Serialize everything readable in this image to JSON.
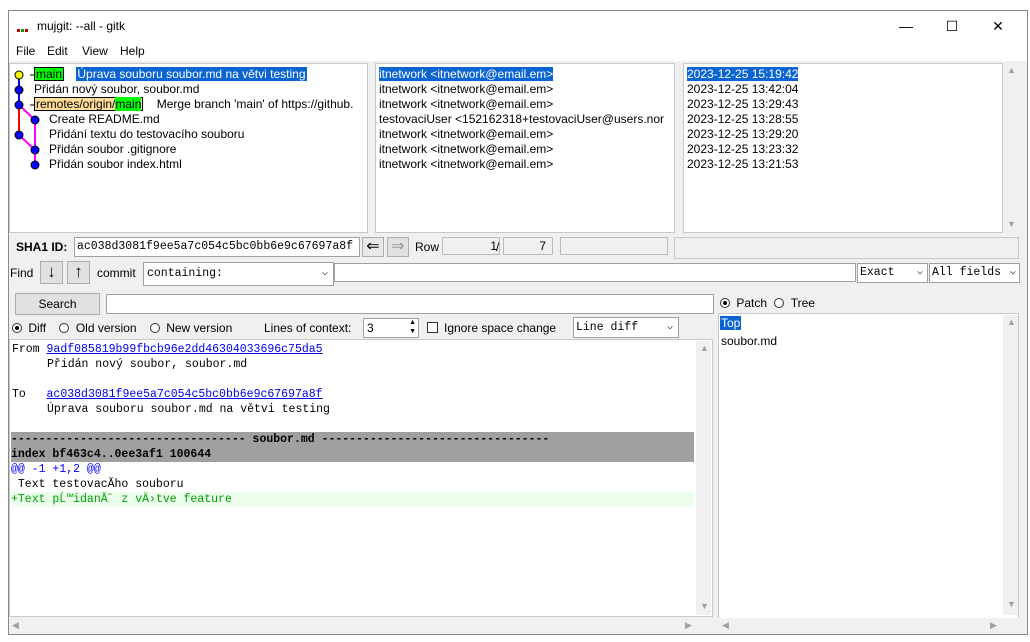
{
  "window": {
    "title": "mujgit: --all - gitk",
    "minimize": "—",
    "maximize": "☐",
    "close": "✕"
  },
  "menu": [
    "File",
    "Edit",
    "View",
    "Help"
  ],
  "commits": [
    {
      "tags": [
        {
          "kind": "main",
          "text": "main"
        }
      ],
      "message": "Úprava souboru soubor.md na větvi testing",
      "author": "itnetwork <itnetwork@email.em>",
      "date": "2023-12-25 15:19:42",
      "selected": true
    },
    {
      "tags": [],
      "message": "Přidán nový soubor, soubor.md",
      "author": "itnetwork <itnetwork@email.em>",
      "date": "2023-12-25 13:42:04",
      "selected": false
    },
    {
      "tags": [
        {
          "kind": "remote",
          "text": "remotes/origin/"
        },
        {
          "kind": "main",
          "text": "main"
        }
      ],
      "message": "Merge branch 'main' of https://github.",
      "author": "itnetwork <itnetwork@email.em>",
      "date": "2023-12-25 13:29:43",
      "selected": false
    },
    {
      "tags": [],
      "message": "Create README.md",
      "author": "testovaciUser <152162318+testovaciUser@users.nor",
      "date": "2023-12-25 13:28:55",
      "selected": false
    },
    {
      "tags": [],
      "message": "Přidání textu do testovacího souboru",
      "author": "itnetwork <itnetwork@email.em>",
      "date": "2023-12-25 13:29:20",
      "selected": false
    },
    {
      "tags": [],
      "message": "Přidán soubor .gitignore",
      "author": "itnetwork <itnetwork@email.em>",
      "date": "2023-12-25 13:23:32",
      "selected": false
    },
    {
      "tags": [],
      "message": "Přidán soubor index.html",
      "author": "itnetwork <itnetwork@email.em>",
      "date": "2023-12-25 13:21:53",
      "selected": false
    }
  ],
  "sha": {
    "label": "SHA1 ID:",
    "value": "ac038d3081f9ee5a7c054c5bc0bb6e9c67697a8f",
    "row_label": "Row",
    "row_current": "1",
    "row_sep": "/",
    "row_total": "7"
  },
  "find": {
    "label": "Find",
    "commit_label": "commit",
    "mode": "containing:",
    "match": "Exact",
    "fields": "All fields"
  },
  "search": {
    "button": "Search"
  },
  "diff_options": {
    "diff": "Diff",
    "old_version": "Old version",
    "new_version": "New version",
    "lines_of_context_label": "Lines of context:",
    "lines_of_context": "3",
    "ignore_space": "Ignore space change",
    "diff_mode": "Line diff"
  },
  "tree_options": {
    "patch": "Patch",
    "tree": "Tree"
  },
  "files": [
    "Top",
    "soubor.md"
  ],
  "diff": {
    "from_label": "From",
    "from_sha": "9adf085819b99fbcb96e2dd46304033696c75da5",
    "from_msg": "Přidán nový soubor, soubor.md",
    "to_label": "To",
    "to_sha": "ac038d3081f9ee5a7c054c5bc0bb6e9c67697a8f",
    "to_msg": "Úprava souboru soubor.md na větvi testing",
    "file_header": "---------------------------------- soubor.md ---------------------------------",
    "index_line": "index bf463c4..0ee3af1 100644",
    "hunk": "@@ -1 +1,2 @@",
    "context_line": " Text testovacĂ­ho souboru",
    "added_line": "+Text pĹ™idanĂ˝ z vÄ›tve feature"
  },
  "colors": {
    "selection": "#0a64d2",
    "main_branch": "#00ff00",
    "remote_branch": "#ffdd99",
    "hunk": "#0000ff",
    "added": "#00a000",
    "file_header_bg": "#a0a0a0"
  }
}
